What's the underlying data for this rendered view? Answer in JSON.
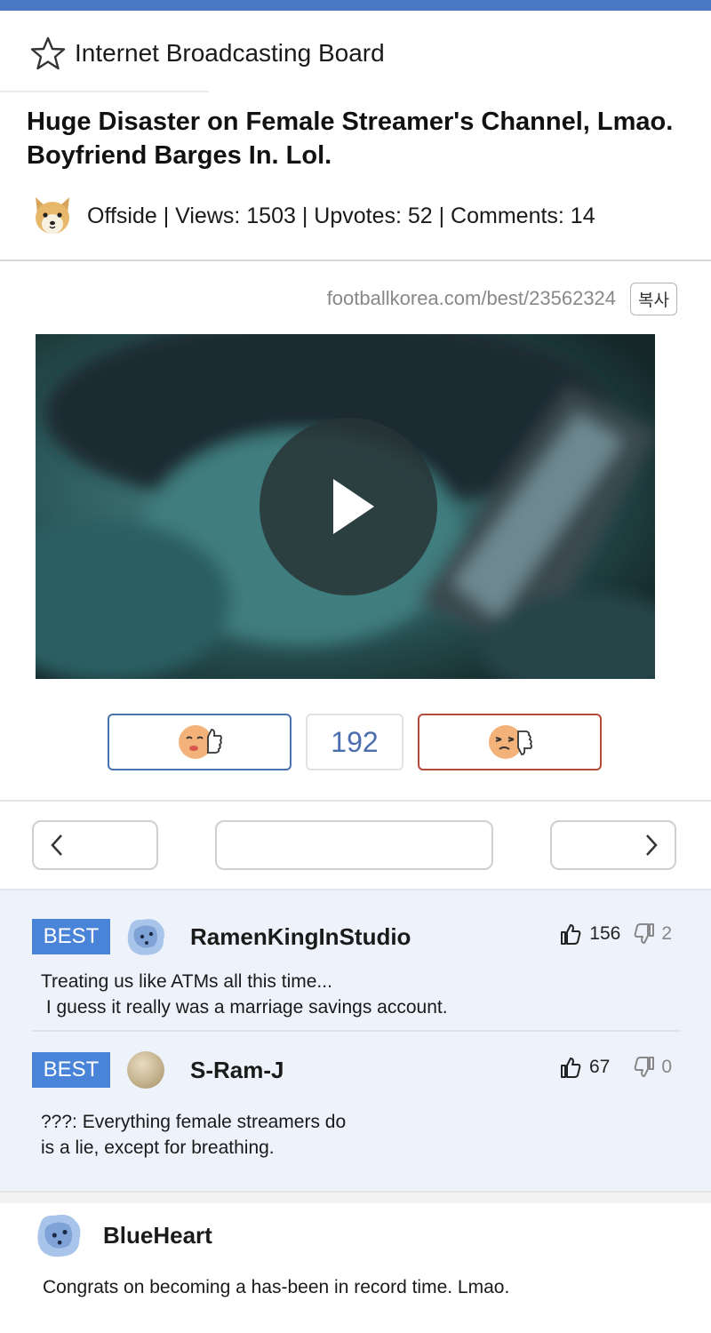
{
  "board": {
    "title": "Internet Broadcasting Board",
    "icon": "star-outline-icon"
  },
  "post": {
    "title": "Huge Disaster on Female Streamer's Channel, Lmao. Boyfriend Barges In. Lol.",
    "author_avatar_icon": "shiba-dog-avatar",
    "meta": "Offside | Views: 1503 | Upvotes: 52 | Comments: 14",
    "url": "footballkorea.com/best/23562324",
    "copy_label": "복사"
  },
  "video": {
    "play_icon": "play-icon"
  },
  "votes": {
    "upvote_icon": "thumbs-up-emoji-icon",
    "count": "192",
    "downvote_icon": "thumbs-down-emoji-icon",
    "upvote_color": "#4a72b0",
    "downvote_color": "#b24a3a"
  },
  "navigation": {
    "prev_icon": "chevron-left-icon",
    "next_icon": "chevron-right-icon"
  },
  "best_comments": [
    {
      "badge": "BEST",
      "author": "RamenKingInStudio",
      "text": "Treating us like ATMs all this time...\n I guess it really was a marriage savings account.",
      "likes": "156",
      "dislikes": "2"
    },
    {
      "badge": "BEST",
      "author": "S-Ram-J",
      "text": "???: Everything female streamers do\nis a lie, except for breathing.",
      "likes": "67",
      "dislikes": "0"
    }
  ],
  "comments": [
    {
      "author": "BlueHeart",
      "text": "Congrats on becoming a has-been in record time. Lmao."
    }
  ],
  "colors": {
    "accent": "#4a78c4",
    "best_badge": "#4a84d8",
    "best_bg": "#edf2fb"
  }
}
